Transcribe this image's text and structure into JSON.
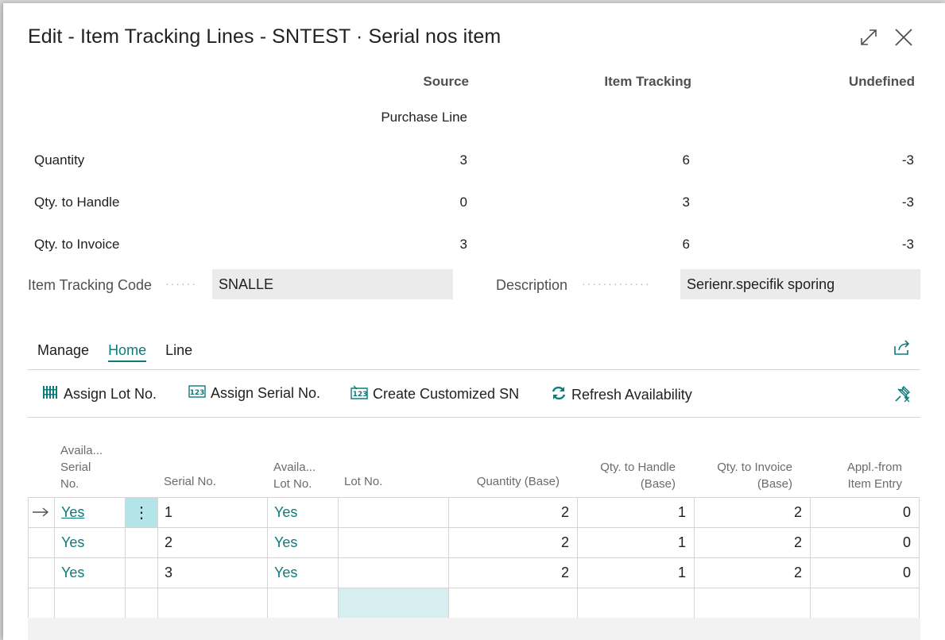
{
  "dialog": {
    "title": "Edit - Item Tracking Lines - SNTEST · Serial nos item"
  },
  "summary": {
    "headers": {
      "source": "Source",
      "item_tracking": "Item Tracking",
      "undefined": "Undefined"
    },
    "source_sub": "Purchase Line",
    "rows": [
      {
        "label": "Quantity",
        "source": "3",
        "tracking": "6",
        "undefined": "-3"
      },
      {
        "label": "Qty. to Handle",
        "source": "0",
        "tracking": "3",
        "undefined": "-3"
      },
      {
        "label": "Qty. to Invoice",
        "source": "3",
        "tracking": "6",
        "undefined": "-3"
      }
    ]
  },
  "fields": {
    "tracking_code_label": "Item Tracking Code",
    "tracking_code_value": "SNALLE",
    "description_label": "Description",
    "description_value": "Serienr.specifik sporing"
  },
  "tabs": [
    "Manage",
    "Home",
    "Line"
  ],
  "active_tab": "Home",
  "actions": {
    "assign_lot": "Assign Lot No.",
    "assign_serial": "Assign Serial No.",
    "create_sn": "Create Customized SN",
    "refresh": "Refresh Availability"
  },
  "columns": {
    "avail_serial": [
      "Availa...",
      "Serial",
      "No."
    ],
    "serial_no": "Serial No.",
    "avail_lot": [
      "Availa...",
      "Lot No."
    ],
    "lot_no": "Lot No.",
    "quantity": "Quantity (Base)",
    "qty_handle": [
      "Qty. to Handle",
      "(Base)"
    ],
    "qty_invoice": [
      "Qty. to Invoice",
      "(Base)"
    ],
    "appl_from": [
      "Appl.-from",
      "Item Entry"
    ]
  },
  "rows": [
    {
      "avail_serial": "Yes",
      "serial_no": "1",
      "avail_lot": "Yes",
      "lot_no": "",
      "quantity": "2",
      "qty_handle": "1",
      "qty_invoice": "2",
      "appl_from": "0"
    },
    {
      "avail_serial": "Yes",
      "serial_no": "2",
      "avail_lot": "Yes",
      "lot_no": "",
      "quantity": "2",
      "qty_handle": "1",
      "qty_invoice": "2",
      "appl_from": "0"
    },
    {
      "avail_serial": "Yes",
      "serial_no": "3",
      "avail_lot": "Yes",
      "lot_no": "",
      "quantity": "2",
      "qty_handle": "1",
      "qty_invoice": "2",
      "appl_from": "0"
    }
  ],
  "colors": {
    "accent": "#0e7a7a",
    "selected_cell": "#b3e5e8",
    "empty_cell": "#d7eef0"
  }
}
